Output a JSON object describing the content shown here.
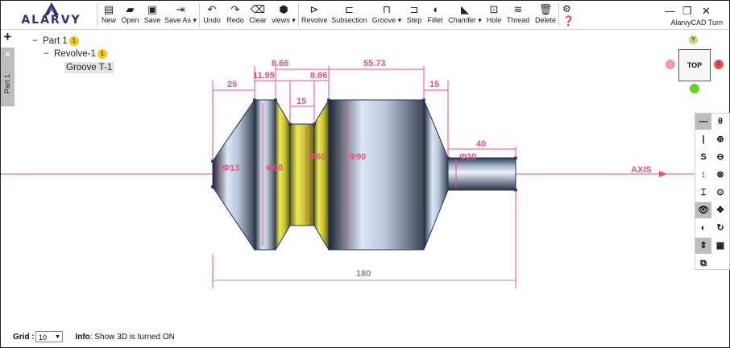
{
  "brand": {
    "logo_text": "ALARVY",
    "app_title": "AlarvyCAD Turn"
  },
  "toolbar": {
    "file": [
      {
        "label": "New",
        "icon": "new-file-icon"
      },
      {
        "label": "Open",
        "icon": "folder-open-icon"
      },
      {
        "label": "Save",
        "icon": "save-icon"
      },
      {
        "label": "Save As",
        "icon": "save-as-icon"
      }
    ],
    "edit": [
      {
        "label": "Undo",
        "icon": "undo-icon"
      },
      {
        "label": "Redo",
        "icon": "redo-icon"
      },
      {
        "label": "Clear",
        "icon": "eraser-icon"
      },
      {
        "label": "views",
        "icon": "cube-icon"
      }
    ],
    "features": [
      {
        "label": "Revolve",
        "icon": "revolve-icon"
      },
      {
        "label": "Subsection",
        "icon": "subsection-icon"
      },
      {
        "label": "Groove",
        "icon": "groove-icon"
      },
      {
        "label": "Step",
        "icon": "step-icon"
      },
      {
        "label": "Fillet",
        "icon": "fillet-icon"
      },
      {
        "label": "Chamfer",
        "icon": "chamfer-icon"
      },
      {
        "label": "Hole",
        "icon": "hole-icon"
      },
      {
        "label": "Thread",
        "icon": "thread-icon"
      },
      {
        "label": "Delete",
        "icon": "trash-icon"
      }
    ]
  },
  "side": {
    "add": "+",
    "close": "✕",
    "tab_label": "Part 1"
  },
  "tree": {
    "part": {
      "label": "Part 1",
      "badge": "1"
    },
    "revolve": {
      "label": "Revolve-1",
      "badge": "1"
    },
    "groove": {
      "label": "Groove T-1"
    }
  },
  "viewcube": {
    "face_label": "TOP",
    "axis_top": "Y",
    "axis_right": "X"
  },
  "drawing": {
    "axis_label": "AXIS",
    "dimensions": {
      "d_25": "25",
      "d_11_95": "11.95",
      "d_8_66_a": "8.66",
      "d_8_66_b": "8.66",
      "d_15_groove": "15",
      "d_55_73": "55.73",
      "d_15_right": "15",
      "d_40": "40",
      "d_180": "180"
    },
    "diameters": {
      "phi13": "Φ13",
      "phi90_left": "Φ90",
      "phi60": "Φ60",
      "phi90_right": "Φ90",
      "phi20": "Φ20"
    }
  },
  "right_panel": {
    "buttons": [
      "—",
      "|",
      "S",
      "↕",
      "⌶",
      "👁",
      "◐",
      "⇕",
      "⧉",
      "θ",
      "⊕",
      "⊖",
      "⊗",
      "⊙",
      "✥",
      "↻",
      "▦"
    ]
  },
  "status": {
    "grid_label": "Grid :",
    "grid_value": "10",
    "info_label": "Info",
    "info_text": ": Show 3D is turned ON"
  },
  "colors": {
    "accent": "#e84f7c",
    "metal_light": "#dfe7f4",
    "metal_dark": "#3b4350",
    "groove": "#d6d233"
  }
}
